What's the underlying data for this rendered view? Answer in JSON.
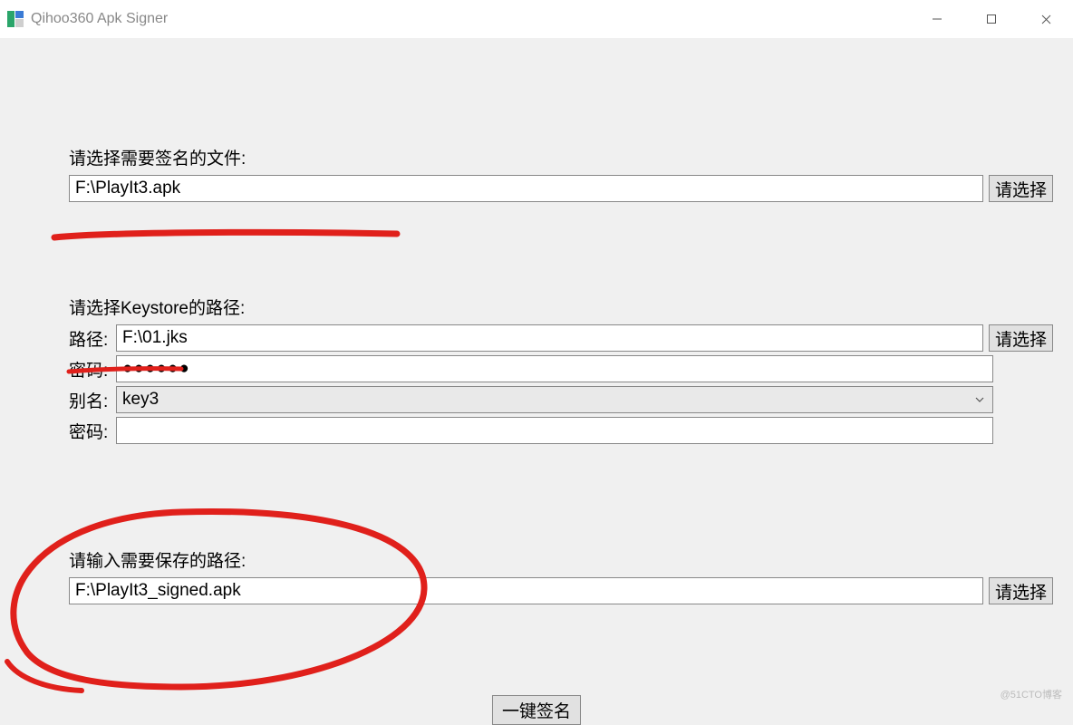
{
  "window": {
    "title": "Qihoo360 Apk Signer"
  },
  "section_file": {
    "label": "请选择需要签名的文件:",
    "value": "F:\\PlayIt3.apk",
    "browse": "请选择"
  },
  "section_keystore": {
    "label": "请选择Keystore的路径:",
    "path_prefix": "路径:",
    "path_value": "F:\\01.jks",
    "path_browse": "请选择",
    "pwd1_prefix": "密码:",
    "pwd1_value": "●●●●●●",
    "alias_prefix": "别名:",
    "alias_value": "key3",
    "pwd2_prefix": "密码:",
    "pwd2_value": ""
  },
  "section_output": {
    "label": "请输入需要保存的路径:",
    "value": "F:\\PlayIt3_signed.apk",
    "browse": "请选择"
  },
  "bottom_button": "一键签名",
  "watermark": "@51CTO博客"
}
